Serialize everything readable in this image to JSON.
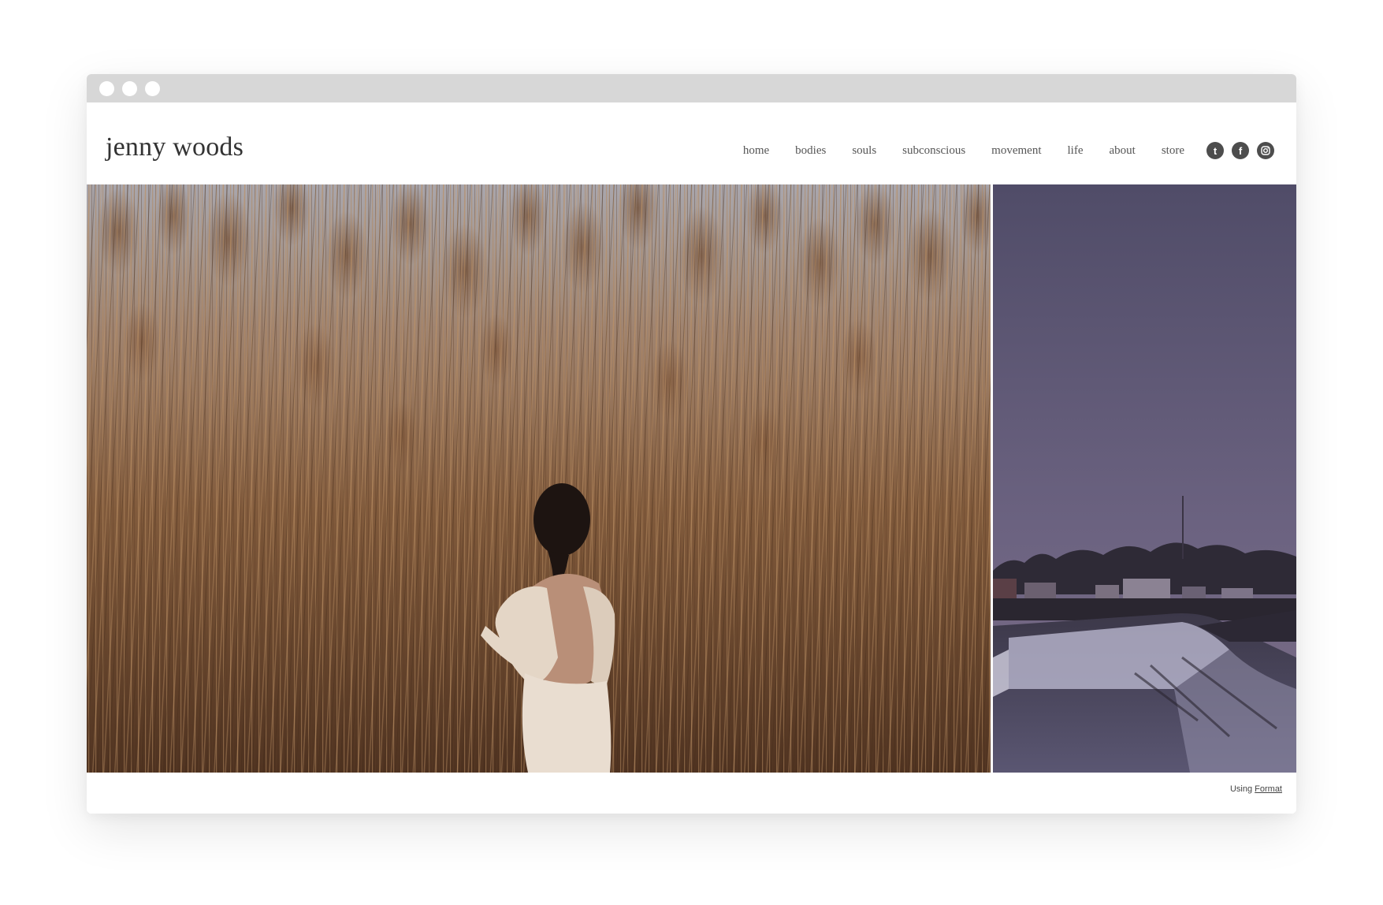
{
  "site": {
    "logo": "jenny woods"
  },
  "nav": {
    "items": [
      {
        "label": "home"
      },
      {
        "label": "bodies"
      },
      {
        "label": "souls"
      },
      {
        "label": "subconscious"
      },
      {
        "label": "movement"
      },
      {
        "label": "life"
      },
      {
        "label": "about"
      },
      {
        "label": "store"
      }
    ]
  },
  "social": {
    "tumblr_glyph": "t",
    "facebook_glyph": "f",
    "instagram_icon": "instagram-icon"
  },
  "footer": {
    "prefix": "Using",
    "link_label": "Format"
  },
  "colors": {
    "titlebar": "#d7d7d7",
    "text": "#555555",
    "icon_bg": "#4d4d4d"
  }
}
